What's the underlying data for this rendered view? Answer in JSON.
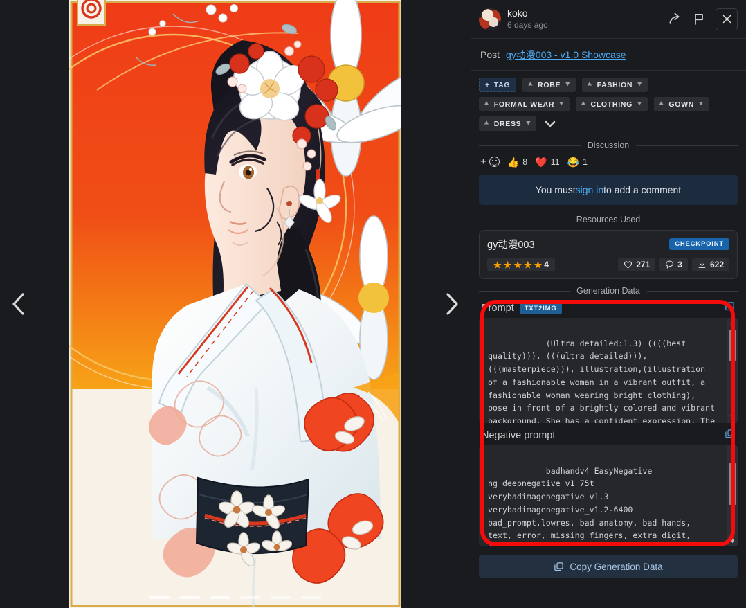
{
  "viewer": {
    "prev_icon": "chevron-left-icon",
    "next_icon": "chevron-right-icon",
    "dash_count": 6,
    "active_dashes": 3
  },
  "header": {
    "username": "koko",
    "timestamp": "6 days ago",
    "share_icon": "share-icon",
    "report_icon": "flag-icon",
    "close_icon": "close-icon"
  },
  "post": {
    "label": "Post",
    "link": "gy动漫003 - v1.0 Showcase"
  },
  "tags": {
    "add_label": "TAG",
    "items": [
      {
        "label": "ROBE"
      },
      {
        "label": "FASHION"
      },
      {
        "label": "FORMAL WEAR"
      },
      {
        "label": "CLOTHING"
      },
      {
        "label": "GOWN"
      },
      {
        "label": "DRESS"
      }
    ],
    "more_icon": "chevron-down-icon"
  },
  "discussion": {
    "section_label": "Discussion",
    "add_reaction_icon": "add-reaction-icon",
    "reactions": [
      {
        "emoji": "👍",
        "name": "thumbs-up",
        "count": "8"
      },
      {
        "emoji": "❤️",
        "name": "heart",
        "count": "11"
      },
      {
        "emoji": "😂",
        "name": "joy",
        "count": "1"
      }
    ],
    "signin_prefix": "You must ",
    "signin_link": "sign in",
    "signin_suffix": " to add a comment"
  },
  "resources": {
    "section_label": "Resources Used",
    "card": {
      "name": "gy动漫003",
      "type_badge": "CHECKPOINT",
      "rating": "4",
      "stars": 5,
      "likes": "271",
      "comments": "3",
      "downloads": "622"
    }
  },
  "generation": {
    "section_label": "Generation Data",
    "highlight_color": "#f40b0b",
    "prompt": {
      "title": "Prompt",
      "badge": "TXT2IMG",
      "copy_icon": "copy-icon",
      "text": "(Ultra detailed:1.3) ((((best quality))), (((ultra detailed))), (((masterpiece))), illustration,(illustration of a fashionable woman in a vibrant outfit, a fashionable woman wearing bright clothing), pose in front of a brightly colored and vibrant background. She has a confident expression, The overall style is bold and eye-catching, emphasizing fashion"
    },
    "negative_prompt": {
      "title": "Negative prompt",
      "copy_icon": "copy-icon",
      "text": "badhandv4 EasyNegative ng_deepnegative_v1_75t verybadimagenegative_v1.3 verybadimagenegative_v1.2-6400 bad_prompt,lowres, bad anatomy, bad hands, text, error, missing fingers, extra digit, fewer digits, cropped, worst quality, low quality,normalquality,jpegartifacts,signature,watermark, username, blurry, watermark, signature, wa"
    },
    "copy_button": {
      "label": "Copy Generation Data",
      "icon": "copy-icon"
    }
  }
}
